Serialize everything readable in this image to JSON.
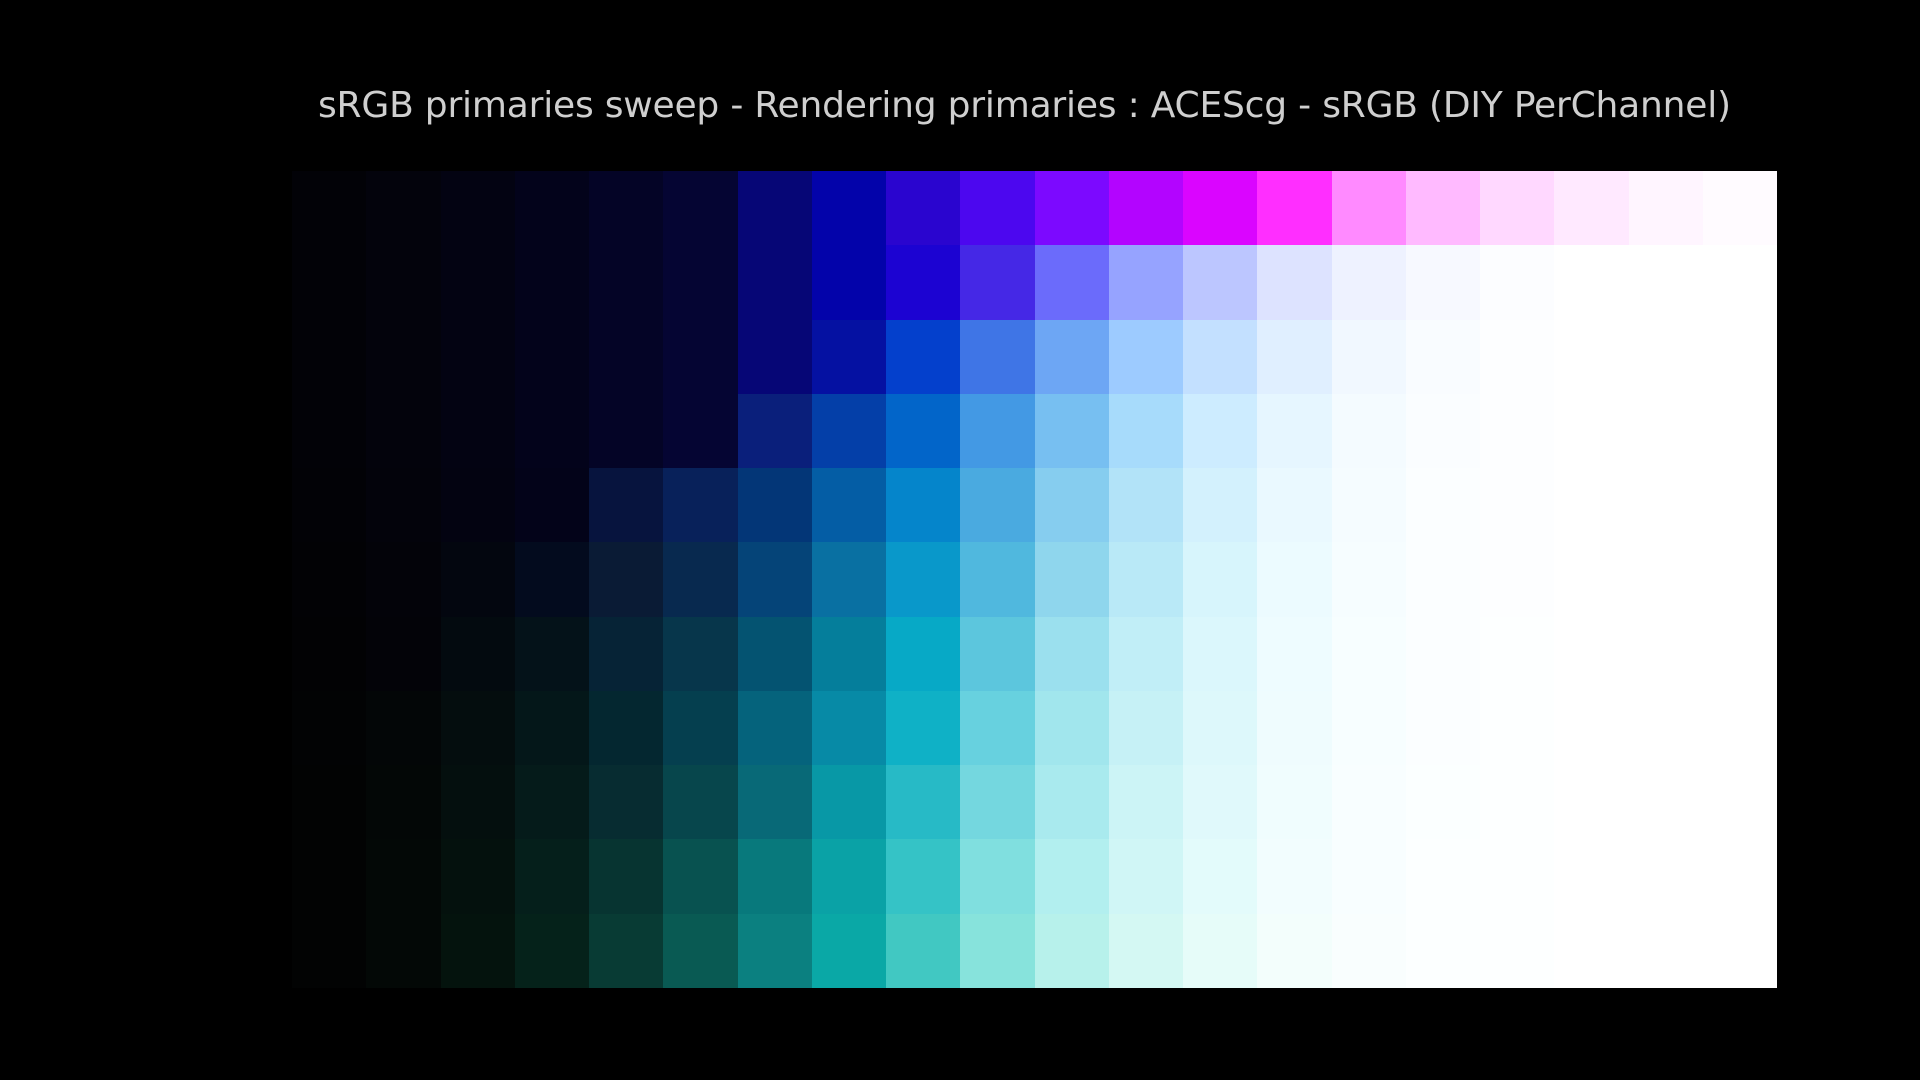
{
  "title": "sRGB primaries sweep - Rendering primaries : ACEScg - sRGB (DIY PerChannel)",
  "colors": {
    "background": "#000000",
    "title": "#cfcfcf"
  },
  "swatch_grid": {
    "columns": 20,
    "rows": 11,
    "row_colors": [
      [
        "#020207",
        "#03030c",
        "#030312",
        "#03031b",
        "#040426",
        "#050533",
        "#060676",
        "#0303aa",
        "#2a05cf",
        "#4c07ef",
        "#7c09ff",
        "#b304ff",
        "#da05ff",
        "#ff2eff",
        "#ff8aff",
        "#ffbaff",
        "#ffd8ff",
        "#ffe9ff",
        "#fff5ff",
        "#fffbff"
      ],
      [
        "#020207",
        "#03030c",
        "#030312",
        "#03031b",
        "#040426",
        "#050533",
        "#060676",
        "#0303aa",
        "#1c03d2",
        "#4528e6",
        "#6b6bfb",
        "#96a3ff",
        "#bcc6ff",
        "#dde3ff",
        "#eef2ff",
        "#f7f9ff",
        "#fcfdff",
        "#ffffff",
        "#ffffff",
        "#ffffff"
      ],
      [
        "#020207",
        "#03030c",
        "#030312",
        "#03031b",
        "#040426",
        "#050533",
        "#060676",
        "#0511a2",
        "#0440cc",
        "#3f75e6",
        "#6da6f4",
        "#9dcbff",
        "#c3e0ff",
        "#e0efff",
        "#f1f8ff",
        "#f9fcff",
        "#fdfeff",
        "#ffffff",
        "#ffffff",
        "#ffffff"
      ],
      [
        "#020207",
        "#03030c",
        "#030312",
        "#03031b",
        "#040426",
        "#050533",
        "#0a1f7b",
        "#043fa8",
        "#0265c9",
        "#4399e4",
        "#77bff1",
        "#a7dbfb",
        "#cdecff",
        "#e6f6ff",
        "#f4fbff",
        "#fafdff",
        "#fdfeff",
        "#ffffff",
        "#ffffff",
        "#ffffff"
      ],
      [
        "#020206",
        "#03030b",
        "#030311",
        "#030319",
        "#07143e",
        "#08215a",
        "#033677",
        "#045da5",
        "#0585cb",
        "#4aaae0",
        "#86cdef",
        "#b2e3f8",
        "#d3f1fd",
        "#eaf9ff",
        "#f5fcff",
        "#fbfeff",
        "#fdfeff",
        "#ffffff",
        "#ffffff",
        "#ffffff"
      ],
      [
        "#020205",
        "#030309",
        "#03060f",
        "#030b1e",
        "#0a1b35",
        "#08294f",
        "#054478",
        "#0970a2",
        "#0998ca",
        "#50b8de",
        "#8fd6ed",
        "#b9e9f7",
        "#d7f5fc",
        "#ecfbff",
        "#f6fdff",
        "#fbfeff",
        "#fdfeff",
        "#ffffff",
        "#ffffff",
        "#ffffff"
      ],
      [
        "#020204",
        "#030308",
        "#030a0f",
        "#041219",
        "#062336",
        "#07364b",
        "#045371",
        "#057e9b",
        "#07a9c6",
        "#5cc6dd",
        "#9be0ee",
        "#c1eef7",
        "#dbf7fc",
        "#eefcff",
        "#f7feff",
        "#fbfeff",
        "#fdffff",
        "#ffffff",
        "#ffffff",
        "#ffffff"
      ],
      [
        "#020304",
        "#030607",
        "#040d0e",
        "#041719",
        "#042730",
        "#053f4f",
        "#05637c",
        "#078aa6",
        "#0fb1c6",
        "#67d1df",
        "#a1e6ed",
        "#c6f1f6",
        "#ddf8fb",
        "#effcfe",
        "#f7feff",
        "#fbfeff",
        "#fdffff",
        "#ffffff",
        "#ffffff",
        "#ffffff"
      ],
      [
        "#020303",
        "#030706",
        "#040f0e",
        "#051b1a",
        "#072c31",
        "#07464c",
        "#086977",
        "#0898a6",
        "#27bac6",
        "#74d7df",
        "#a9eaee",
        "#ccf4f6",
        "#e0f9fb",
        "#f0fdfe",
        "#f8feff",
        "#fbffff",
        "#fdffff",
        "#ffffff",
        "#ffffff",
        "#ffffff"
      ],
      [
        "#020303",
        "#030806",
        "#04110d",
        "#051f1b",
        "#073431",
        "#085250",
        "#08797c",
        "#0aa2a6",
        "#35c3c6",
        "#80dfdf",
        "#b2efef",
        "#d0f6f6",
        "#e3fbfb",
        "#f2fdfe",
        "#f8feff",
        "#fcffff",
        "#fdffff",
        "#ffffff",
        "#ffffff",
        "#ffffff"
      ],
      [
        "#020303",
        "#030806",
        "#04130d",
        "#05221a",
        "#083b34",
        "#095a53",
        "#0b8080",
        "#0aa8a6",
        "#41c8c2",
        "#87e3dc",
        "#b7f1eb",
        "#d4f8f3",
        "#e6fcf9",
        "#f3fefc",
        "#f9fefe",
        "#fcffff",
        "#fdffff",
        "#ffffff",
        "#ffffff",
        "#ffffff"
      ]
    ]
  }
}
